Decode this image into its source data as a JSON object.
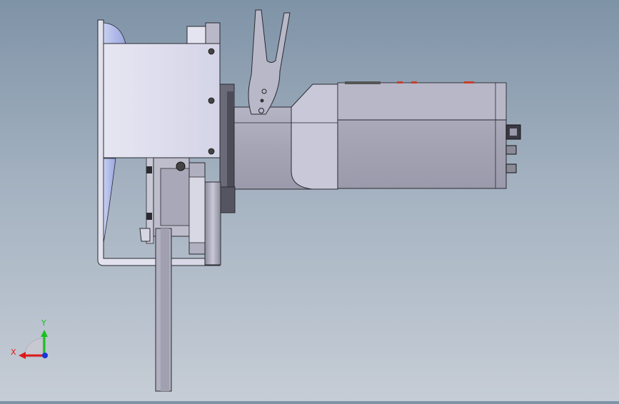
{
  "viewport": {
    "background_top": "#7f93a7",
    "background_bottom": "#c6cdd6"
  },
  "model": {
    "view": "front",
    "components": [
      "mounting-bracket",
      "side-plate",
      "housing-block",
      "fork-lever",
      "cylindrical-body",
      "motor-body",
      "connector-end",
      "flange-disk",
      "gear-block",
      "vertical-shaft"
    ]
  },
  "triad": {
    "x_label": "X",
    "y_label": "Y",
    "x_color": "#e01818",
    "y_color": "#19c01e",
    "z_color": "#1835d8"
  },
  "colors": {
    "plate": "#dcdcee",
    "body": "#a6a6b6",
    "body_light": "#c4c4d4",
    "outline": "#2a2a30",
    "dark": "#3a3a44",
    "accent_red": "#c8402a"
  }
}
